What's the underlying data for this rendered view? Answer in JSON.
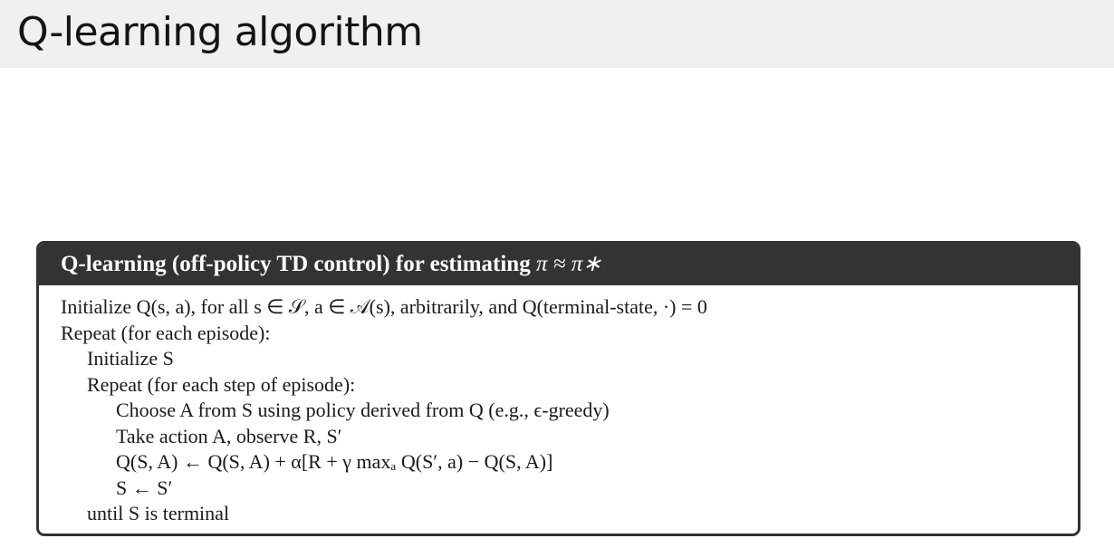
{
  "slide": {
    "title": "Q-learning algorithm"
  },
  "algorithm": {
    "header": "Q-learning (off-policy TD control) for estimating π ≈ π*",
    "header_text": "Q-learning (off-policy TD control) for estimating ",
    "header_math": "π ≈ π∗",
    "lines": [
      {
        "indent": 0,
        "text": "Initialize Q(s, a), for all s ∈ 𝒮, a ∈ 𝒜(s), arbitrarily, and Q(terminal-state, ·) = 0"
      },
      {
        "indent": 0,
        "text": "Repeat (for each episode):"
      },
      {
        "indent": 1,
        "text": "Initialize S"
      },
      {
        "indent": 1,
        "text": "Repeat (for each step of episode):"
      },
      {
        "indent": 2,
        "text": "Choose A from S using policy derived from Q (e.g., ϵ-greedy)"
      },
      {
        "indent": 2,
        "text": "Take action A, observe R, S′"
      },
      {
        "indent": 2,
        "text": "Q(S, A) ← Q(S, A) + α[R + γ maxₐ Q(S′, a) − Q(S, A)]"
      },
      {
        "indent": 2,
        "text": "S ← S′"
      },
      {
        "indent": 1,
        "text": "until S is terminal"
      }
    ]
  },
  "colors": {
    "title_bar_bg": "#f0f0f0",
    "box_header_bg": "#333333",
    "box_border": "#333333"
  }
}
